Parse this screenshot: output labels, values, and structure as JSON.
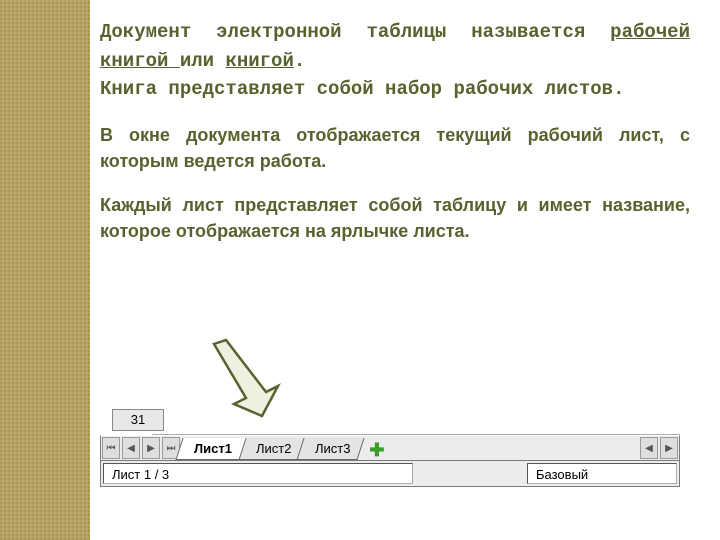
{
  "text": {
    "p1_prefix": "Документ электронной таблицы  называется ",
    "p1_u1": "рабочей книгой ",
    "p1_mid": "или ",
    "p1_u2": "книгой",
    "p1_dot": ".",
    "p1_line2": "Книга представляет собой набор рабочих листов.",
    "p2": "В окне документа отображается текущий рабочий лист, с которым ведется работа.",
    "p3": "Каждый лист представляет собой таблицу и имеет название, которое отображается на ярлычке листа."
  },
  "sheet": {
    "row_number": "31",
    "tabs": [
      "Лист1",
      "Лист2",
      "Лист3"
    ],
    "nav": {
      "first": "⏮",
      "prev": "◀",
      "next": "▶",
      "last": "⏭",
      "scroll_left": "◀",
      "scroll_right": "▶"
    },
    "add_icon": "✚",
    "status_left": "Лист 1 / 3",
    "status_right": "Базовый"
  }
}
